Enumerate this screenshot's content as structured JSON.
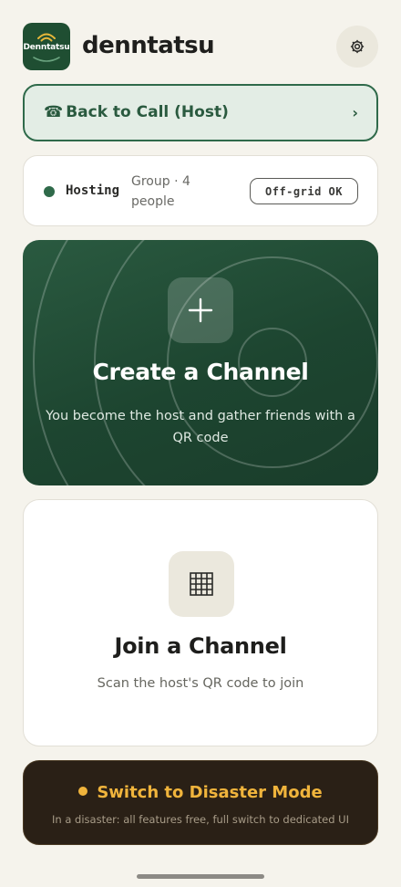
{
  "app": {
    "logo_text": "Denntatsu",
    "title": "denntatsu"
  },
  "back_to_call": {
    "icon": "phone-icon",
    "phone_glyph": "☎",
    "label": "Back to Call (Host)",
    "chevron": "›"
  },
  "status": {
    "label": "Hosting",
    "sub": "Group · 4 people",
    "badge": "Off-grid OK",
    "dot_color": "#2f6a4a"
  },
  "create_channel": {
    "icon": "plus-icon",
    "title": "Create a Channel",
    "subtitle": "You become the host and gather friends with a QR code"
  },
  "join_channel": {
    "icon": "qr-grid-icon",
    "title": "Join a Channel",
    "subtitle": "Scan the host's QR code to join"
  },
  "disaster": {
    "title": "Switch to Disaster Mode",
    "subtitle": "In a disaster: all features free, full switch to dedicated UI",
    "accent": "#f0b43c"
  },
  "colors": {
    "brand_green": "#1f4e32",
    "background": "#f5f3ec"
  }
}
